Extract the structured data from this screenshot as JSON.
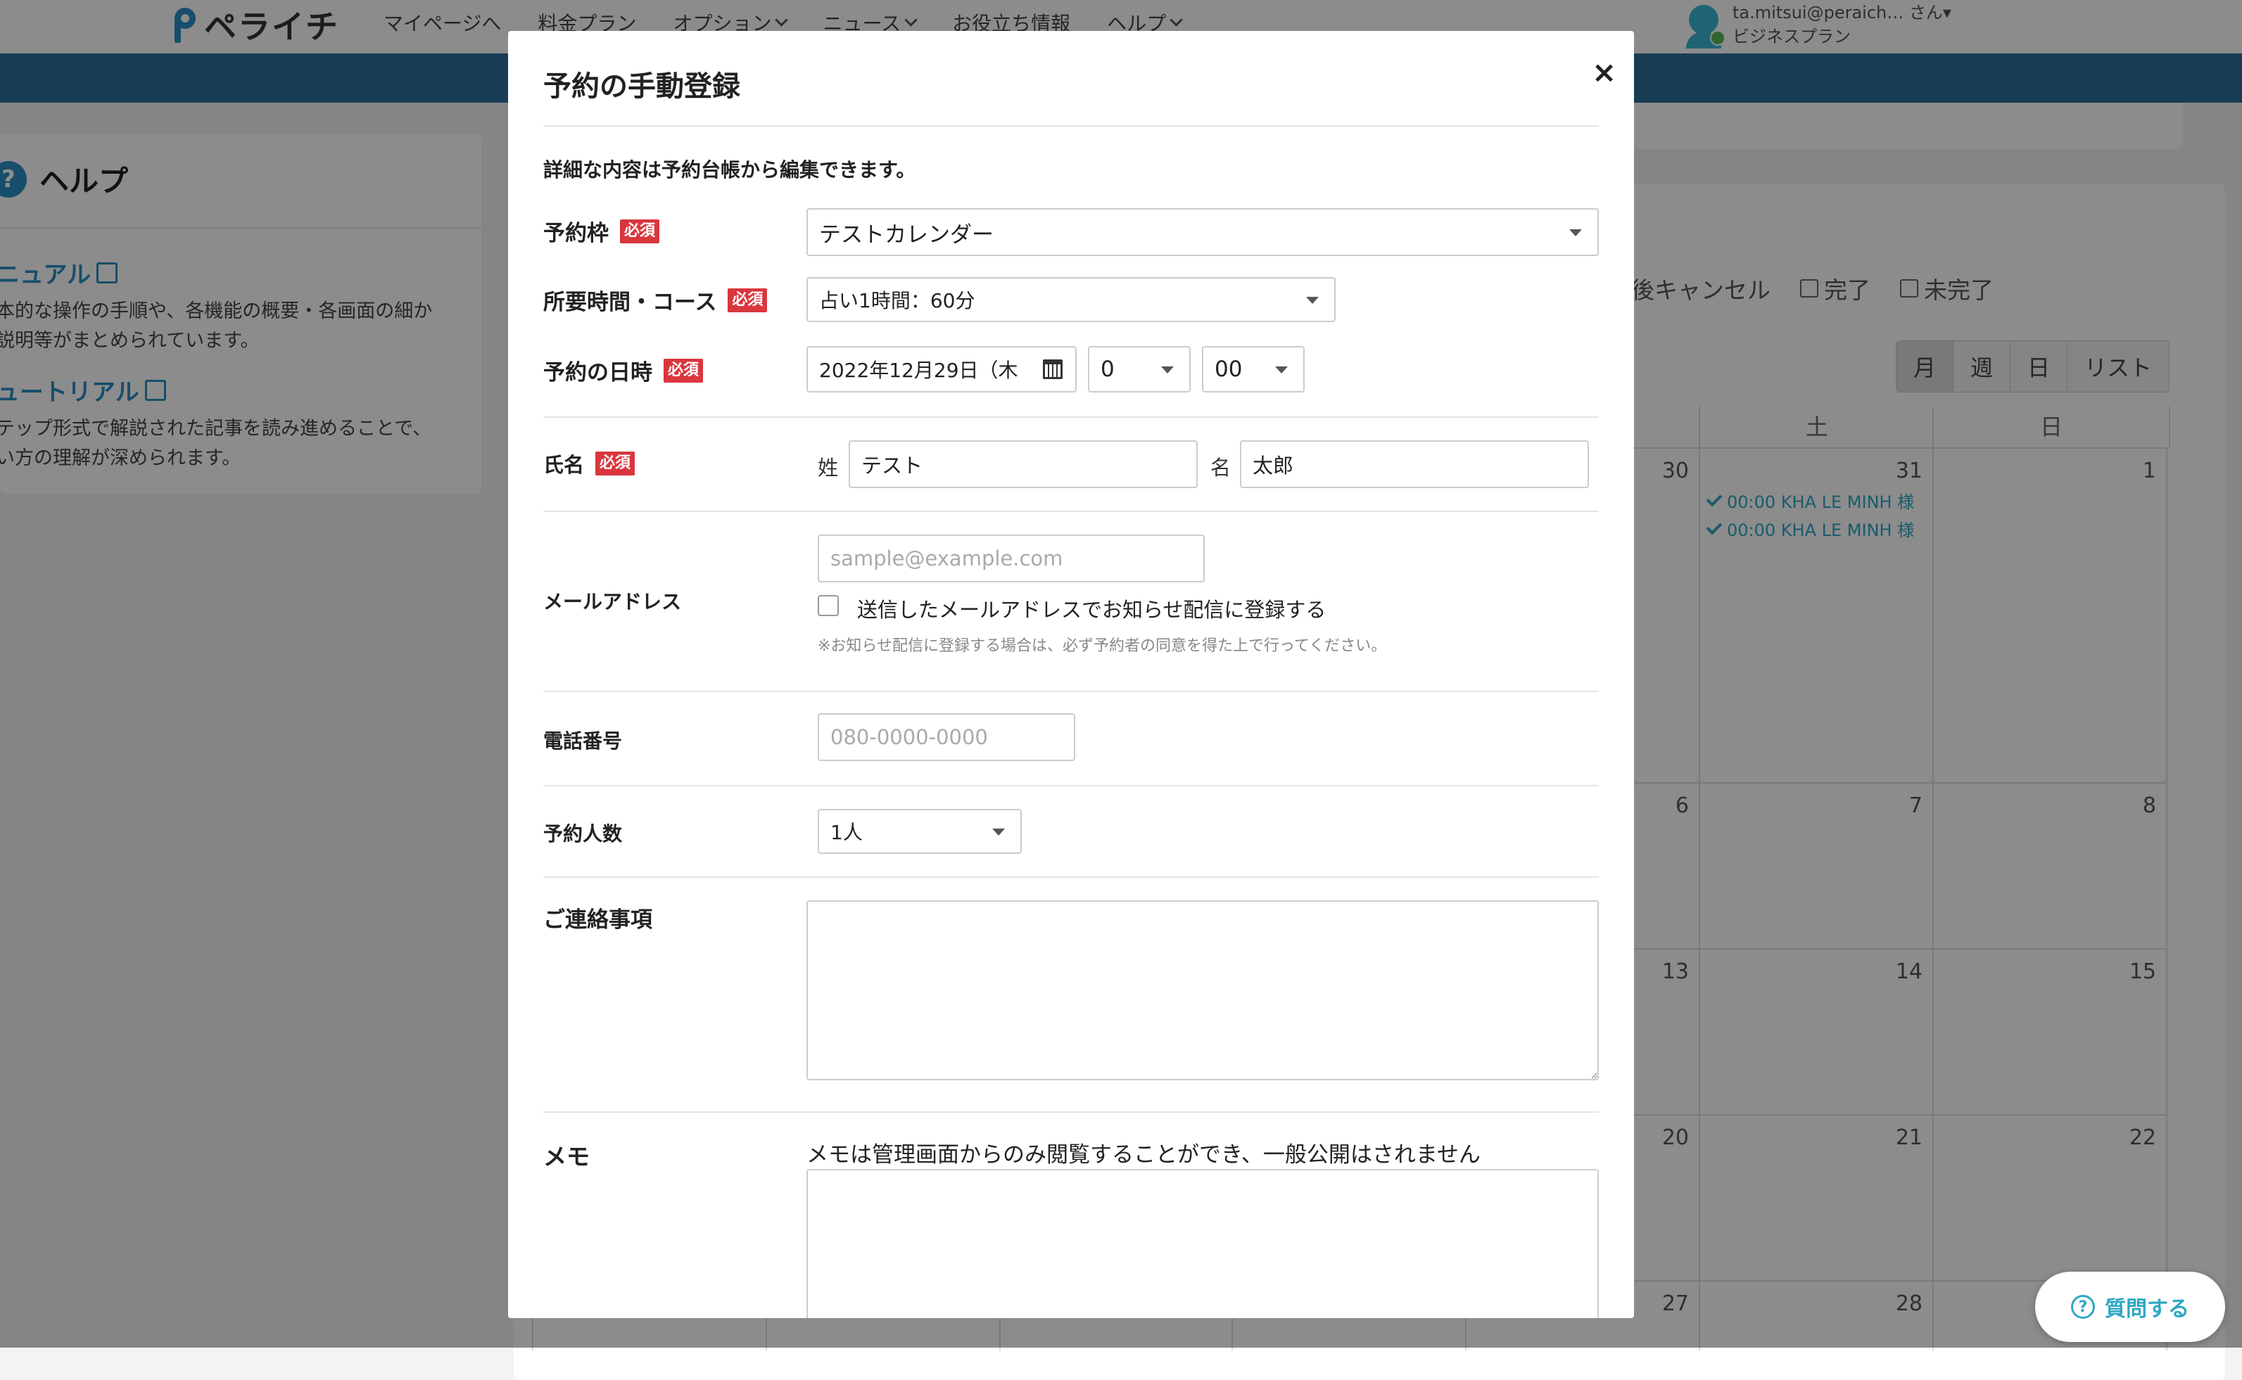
{
  "header": {
    "logo_text": "ペライチ",
    "nav": [
      {
        "label": "マイページへ",
        "has_dropdown": false
      },
      {
        "label": "料金プラン",
        "has_dropdown": false
      },
      {
        "label": "オプション",
        "has_dropdown": true
      },
      {
        "label": "ニュース",
        "has_dropdown": true
      },
      {
        "label": "お役立ち情報",
        "has_dropdown": false
      },
      {
        "label": "ヘルプ",
        "has_dropdown": true
      }
    ],
    "account": {
      "email": "ta.mitsui@peraich… さん▾",
      "plan": "ビジネスプラン"
    }
  },
  "help": {
    "title": "ヘルプ",
    "links": [
      {
        "title": "ニュアル",
        "desc_line1": "本的な操作の手順や、各機能の概要・各画面の細か",
        "desc_line2": "説明等がまとめられています。"
      },
      {
        "title": "ュートリアル",
        "desc_line1": "テップ形式で解説された記事を読み進めることで、",
        "desc_line2": "い方の理解が深められます。"
      }
    ]
  },
  "calendar": {
    "filters": [
      "後キャンセル",
      "完了",
      "未完了"
    ],
    "views": [
      "月",
      "週",
      "日",
      "リスト"
    ],
    "weekday_headers": [
      "土",
      "日"
    ],
    "cells": [
      {
        "day": "30"
      },
      {
        "day": "31"
      },
      {
        "day": "1"
      },
      {
        "day": "6"
      },
      {
        "day": "7"
      },
      {
        "day": "8"
      },
      {
        "day": "13"
      },
      {
        "day": "14"
      },
      {
        "day": "15"
      },
      {
        "day": "20"
      },
      {
        "day": "21"
      },
      {
        "day": "22"
      },
      {
        "day": "27"
      },
      {
        "day": "28"
      },
      {
        "day": ""
      }
    ],
    "events": [
      "00:00 KHA LE MINH 様",
      "00:00 KHA LE MINH 様"
    ]
  },
  "modal": {
    "title": "予約の手動登録",
    "close": "×",
    "intro": "詳細な内容は予約台帳から編集できます。",
    "required_badge": "必須",
    "frame": {
      "label": "予約枠",
      "value": "テストカレンダー"
    },
    "course": {
      "label": "所要時間・コース",
      "value": "占い1時間：60分"
    },
    "datetime": {
      "label": "予約の日時",
      "date": "2022年12月29日（木",
      "hour": "0",
      "minute": "00"
    },
    "name": {
      "label": "氏名",
      "last_label": "姓",
      "last_value": "テスト",
      "first_label": "名",
      "first_value": "太郎"
    },
    "email": {
      "label": "メールアドレス",
      "placeholder": "sample@example.com",
      "checkbox_label": "送信したメールアドレスでお知らせ配信に登録する",
      "note": "※お知らせ配信に登録する場合は、必ず予約者の同意を得た上で行ってください。"
    },
    "phone": {
      "label": "電話番号",
      "placeholder": "080-0000-0000"
    },
    "people": {
      "label": "予約人数",
      "value": "1人"
    },
    "contact": {
      "label": "ご連絡事項"
    },
    "memo": {
      "label": "メモ",
      "description": "メモは管理画面からのみ閲覧することができ、一般公開はされません"
    }
  },
  "help_button": {
    "label": "質問する"
  }
}
